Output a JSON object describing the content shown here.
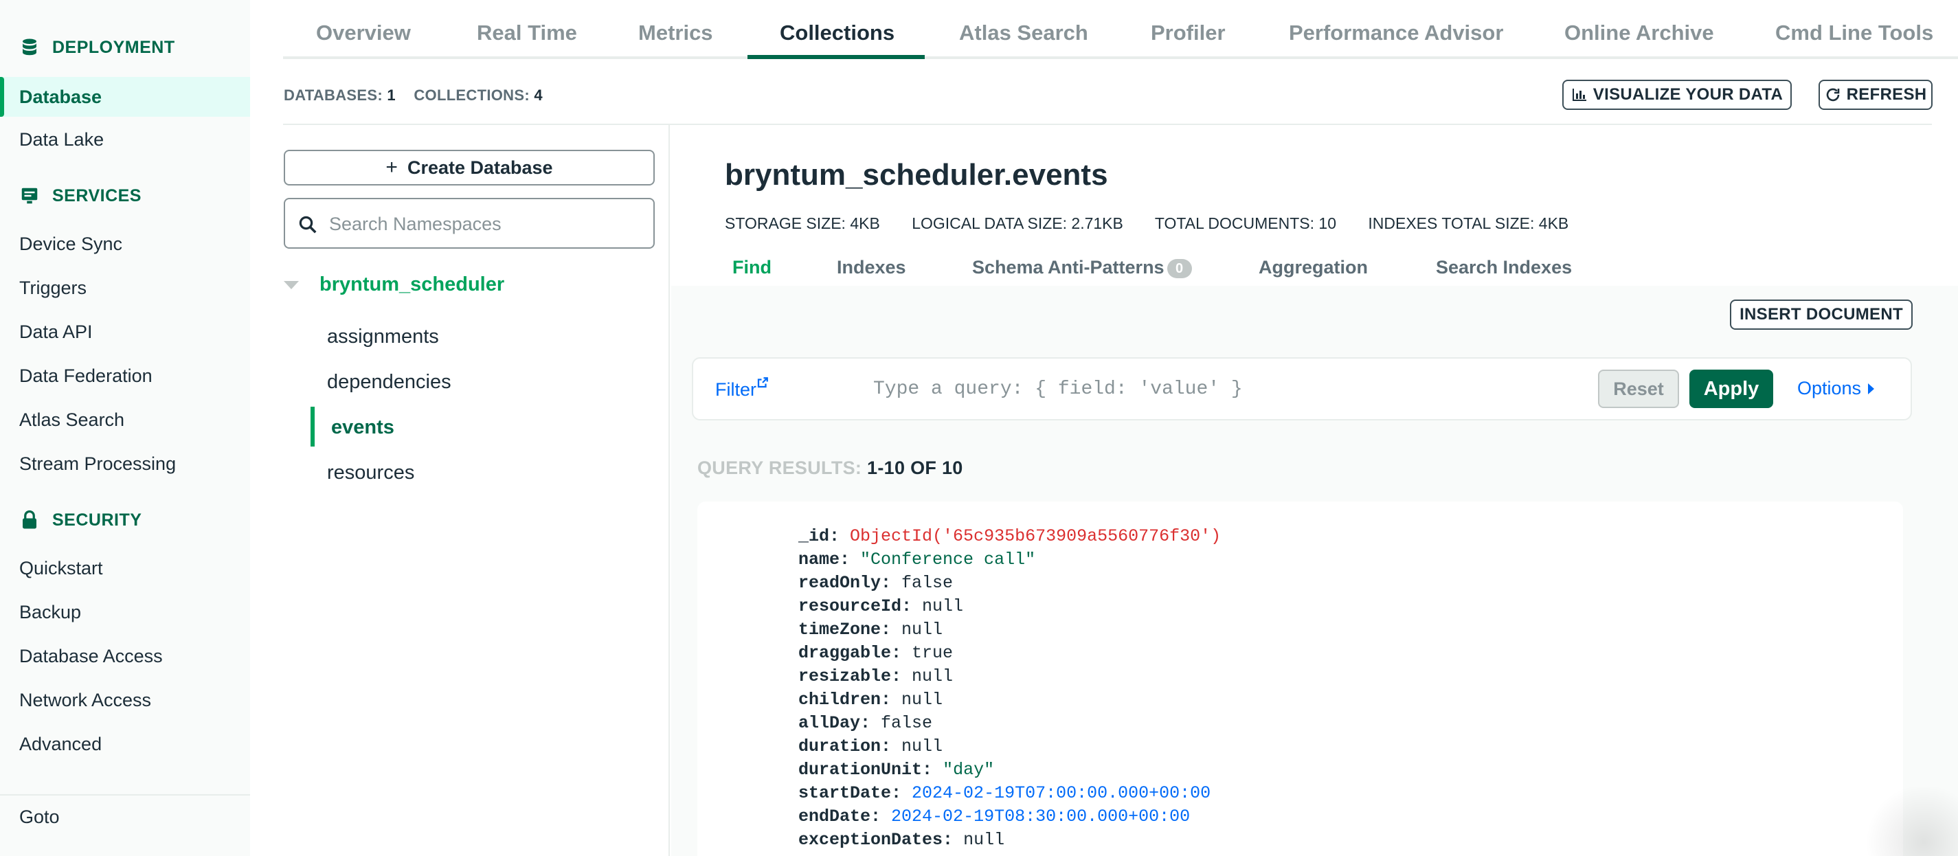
{
  "sidebar": {
    "deployment_label": "DEPLOYMENT",
    "database": "Database",
    "data_lake": "Data Lake",
    "services_label": "SERVICES",
    "device_sync": "Device Sync",
    "triggers": "Triggers",
    "data_api": "Data API",
    "data_federation": "Data Federation",
    "atlas_search": "Atlas Search",
    "stream_processing": "Stream Processing",
    "security_label": "SECURITY",
    "quickstart": "Quickstart",
    "backup": "Backup",
    "database_access": "Database Access",
    "network_access": "Network Access",
    "advanced": "Advanced",
    "goto": "Goto"
  },
  "tabs": {
    "overview": "Overview",
    "real_time": "Real Time",
    "metrics": "Metrics",
    "collections": "Collections",
    "atlas_search": "Atlas Search",
    "profiler": "Profiler",
    "performance_advisor": "Performance Advisor",
    "online_archive": "Online Archive",
    "cmd_line_tools": "Cmd Line Tools"
  },
  "summary": {
    "databases_label": "DATABASES:",
    "databases_count": "1",
    "collections_label": "COLLECTIONS:",
    "collections_count": "4"
  },
  "toolbar": {
    "visualize": "VISUALIZE YOUR DATA",
    "refresh": "REFRESH"
  },
  "namespace": {
    "create_db": "Create Database",
    "search_placeholder": "Search Namespaces",
    "db_name": "bryntum_scheduler",
    "collections": [
      "assignments",
      "dependencies",
      "events",
      "resources"
    ]
  },
  "collection": {
    "title": "bryntum_scheduler.events",
    "storage_label": "STORAGE SIZE:",
    "storage_value": "4KB",
    "logical_label": "LOGICAL DATA SIZE:",
    "logical_value": "2.71KB",
    "docs_label": "TOTAL DOCUMENTS:",
    "docs_value": "10",
    "indexes_label": "INDEXES TOTAL SIZE:",
    "indexes_value": "4KB",
    "subtabs": {
      "find": "Find",
      "indexes": "Indexes",
      "schema": "Schema Anti-Patterns",
      "schema_badge": "0",
      "aggregation": "Aggregation",
      "search_indexes": "Search Indexes"
    },
    "insert_document": "INSERT DOCUMENT"
  },
  "filter": {
    "label": "Filter",
    "placeholder": "Type a query: { field: 'value' }",
    "reset": "Reset",
    "apply": "Apply",
    "options": "Options"
  },
  "results": {
    "label": "QUERY RESULTS:",
    "range": "1-10 OF 10"
  },
  "document": {
    "fields": [
      {
        "key": "_id:",
        "value": "ObjectId('65c935b673909a5560776f30')"
      },
      {
        "key": "name:",
        "value": "\"Conference call\""
      },
      {
        "key": "readOnly:",
        "value": "false"
      },
      {
        "key": "resourceId:",
        "value": "null"
      },
      {
        "key": "timeZone:",
        "value": "null"
      },
      {
        "key": "draggable:",
        "value": "true"
      },
      {
        "key": "resizable:",
        "value": "null"
      },
      {
        "key": "children:",
        "value": "null"
      },
      {
        "key": "allDay:",
        "value": "false"
      },
      {
        "key": "duration:",
        "value": "null"
      },
      {
        "key": "durationUnit:",
        "value": "\"day\""
      },
      {
        "key": "startDate:",
        "value": "2024-02-19T07:00:00.000+00:00"
      },
      {
        "key": "endDate:",
        "value": "2024-02-19T08:30:00.000+00:00"
      },
      {
        "key": "exceptionDates:",
        "value": "null"
      }
    ]
  }
}
